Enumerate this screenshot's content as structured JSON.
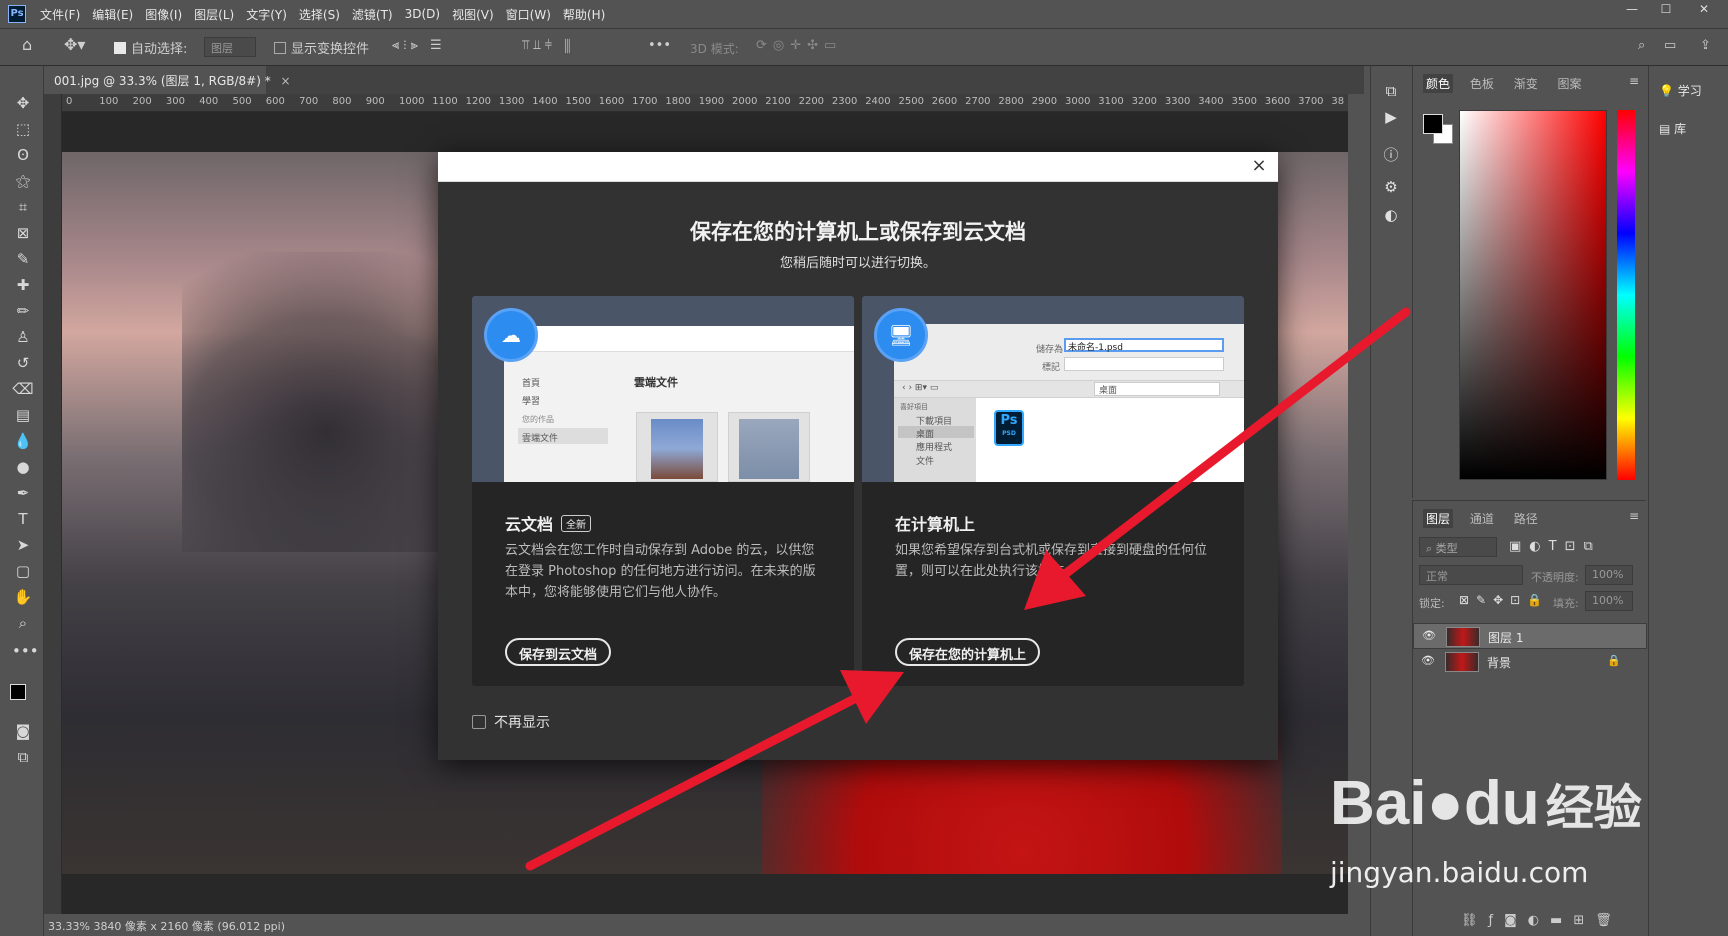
{
  "app": {
    "logo": "Ps"
  },
  "menu": [
    "文件(F)",
    "编辑(E)",
    "图像(I)",
    "图层(L)",
    "文字(Y)",
    "选择(S)",
    "滤镜(T)",
    "3D(D)",
    "视图(V)",
    "窗口(W)",
    "帮助(H)"
  ],
  "options": {
    "auto_select": "自动选择:",
    "layer_select": "图层",
    "show_transform": "显示变换控件",
    "mode3d": "3D 模式:"
  },
  "document": {
    "tab_title": "001.jpg @ 33.3% (图层 1, RGB/8#) *"
  },
  "ruler": [
    "0",
    "100",
    "200",
    "300",
    "400",
    "500",
    "600",
    "700",
    "800",
    "900",
    "1000",
    "1100",
    "1200",
    "1300",
    "1400",
    "1500",
    "1600",
    "1700",
    "1800",
    "1900",
    "2000",
    "2100",
    "2200",
    "2300",
    "2400",
    "2500",
    "2600",
    "2700",
    "2800",
    "2900",
    "3000",
    "3100",
    "3200",
    "3300",
    "3400",
    "3500",
    "3600",
    "3700",
    "38"
  ],
  "status": {
    "text": "33.33%  3840 像素 x 2160 像素 (96.012 ppi)"
  },
  "dialog": {
    "title": "保存在您的计算机上或保存到云文档",
    "subtitle": "您稍后随时可以进行切换。",
    "close": "×",
    "cloud": {
      "heading": "云文档",
      "badge": "全新",
      "body": "云文档会在您工作时自动保存到 Adobe 的云，以供您在登录 Photoshop 的任何地方进行访问。在未来的版本中，您将能够使用它们与他人协作。",
      "button": "保存到云文档",
      "mock_title": "雲端文件",
      "mock_nav": [
        "首頁",
        "學習",
        "您的作品",
        "雲端文件"
      ]
    },
    "local": {
      "heading": "在计算机上",
      "body": "如果您希望保存到台式机或保存到直接到硬盘的任何位置，则可以在此处执行该操作。",
      "button": "保存在您的计算机上",
      "mock_saveas_label": "儲存為",
      "mock_saveas": "未命名-1.psd",
      "mock_tag_label": "標記",
      "mock_loc": "桌面",
      "mock_side": [
        "喜好項目",
        "下載項目",
        "桌面",
        "應用程式",
        "文件"
      ],
      "mock_file": "Ps",
      "mock_file_ext": "PSD"
    },
    "dont_show": "不再显示"
  },
  "color_panel": {
    "tabs": [
      "颜色",
      "色板",
      "渐变",
      "图案"
    ]
  },
  "layers_panel": {
    "tabs": [
      "图层",
      "通道",
      "路径"
    ],
    "filter": "类型",
    "blend": "正常",
    "opacity_label": "不透明度:",
    "opacity": "100%",
    "lock_label": "锁定:",
    "fill_label": "填充:",
    "fill": "100%",
    "layers": [
      {
        "name": "图层 1"
      },
      {
        "name": "背景"
      }
    ]
  },
  "learn_panel": {
    "learn": "学习",
    "library": "库"
  },
  "watermark": {
    "brand": "Bai",
    "brand2": "du",
    "cn": "经验",
    "url": "jingyan.baidu.com"
  },
  "colors": {
    "accent": "#2d8cf0",
    "arrow": "#e8192c"
  }
}
